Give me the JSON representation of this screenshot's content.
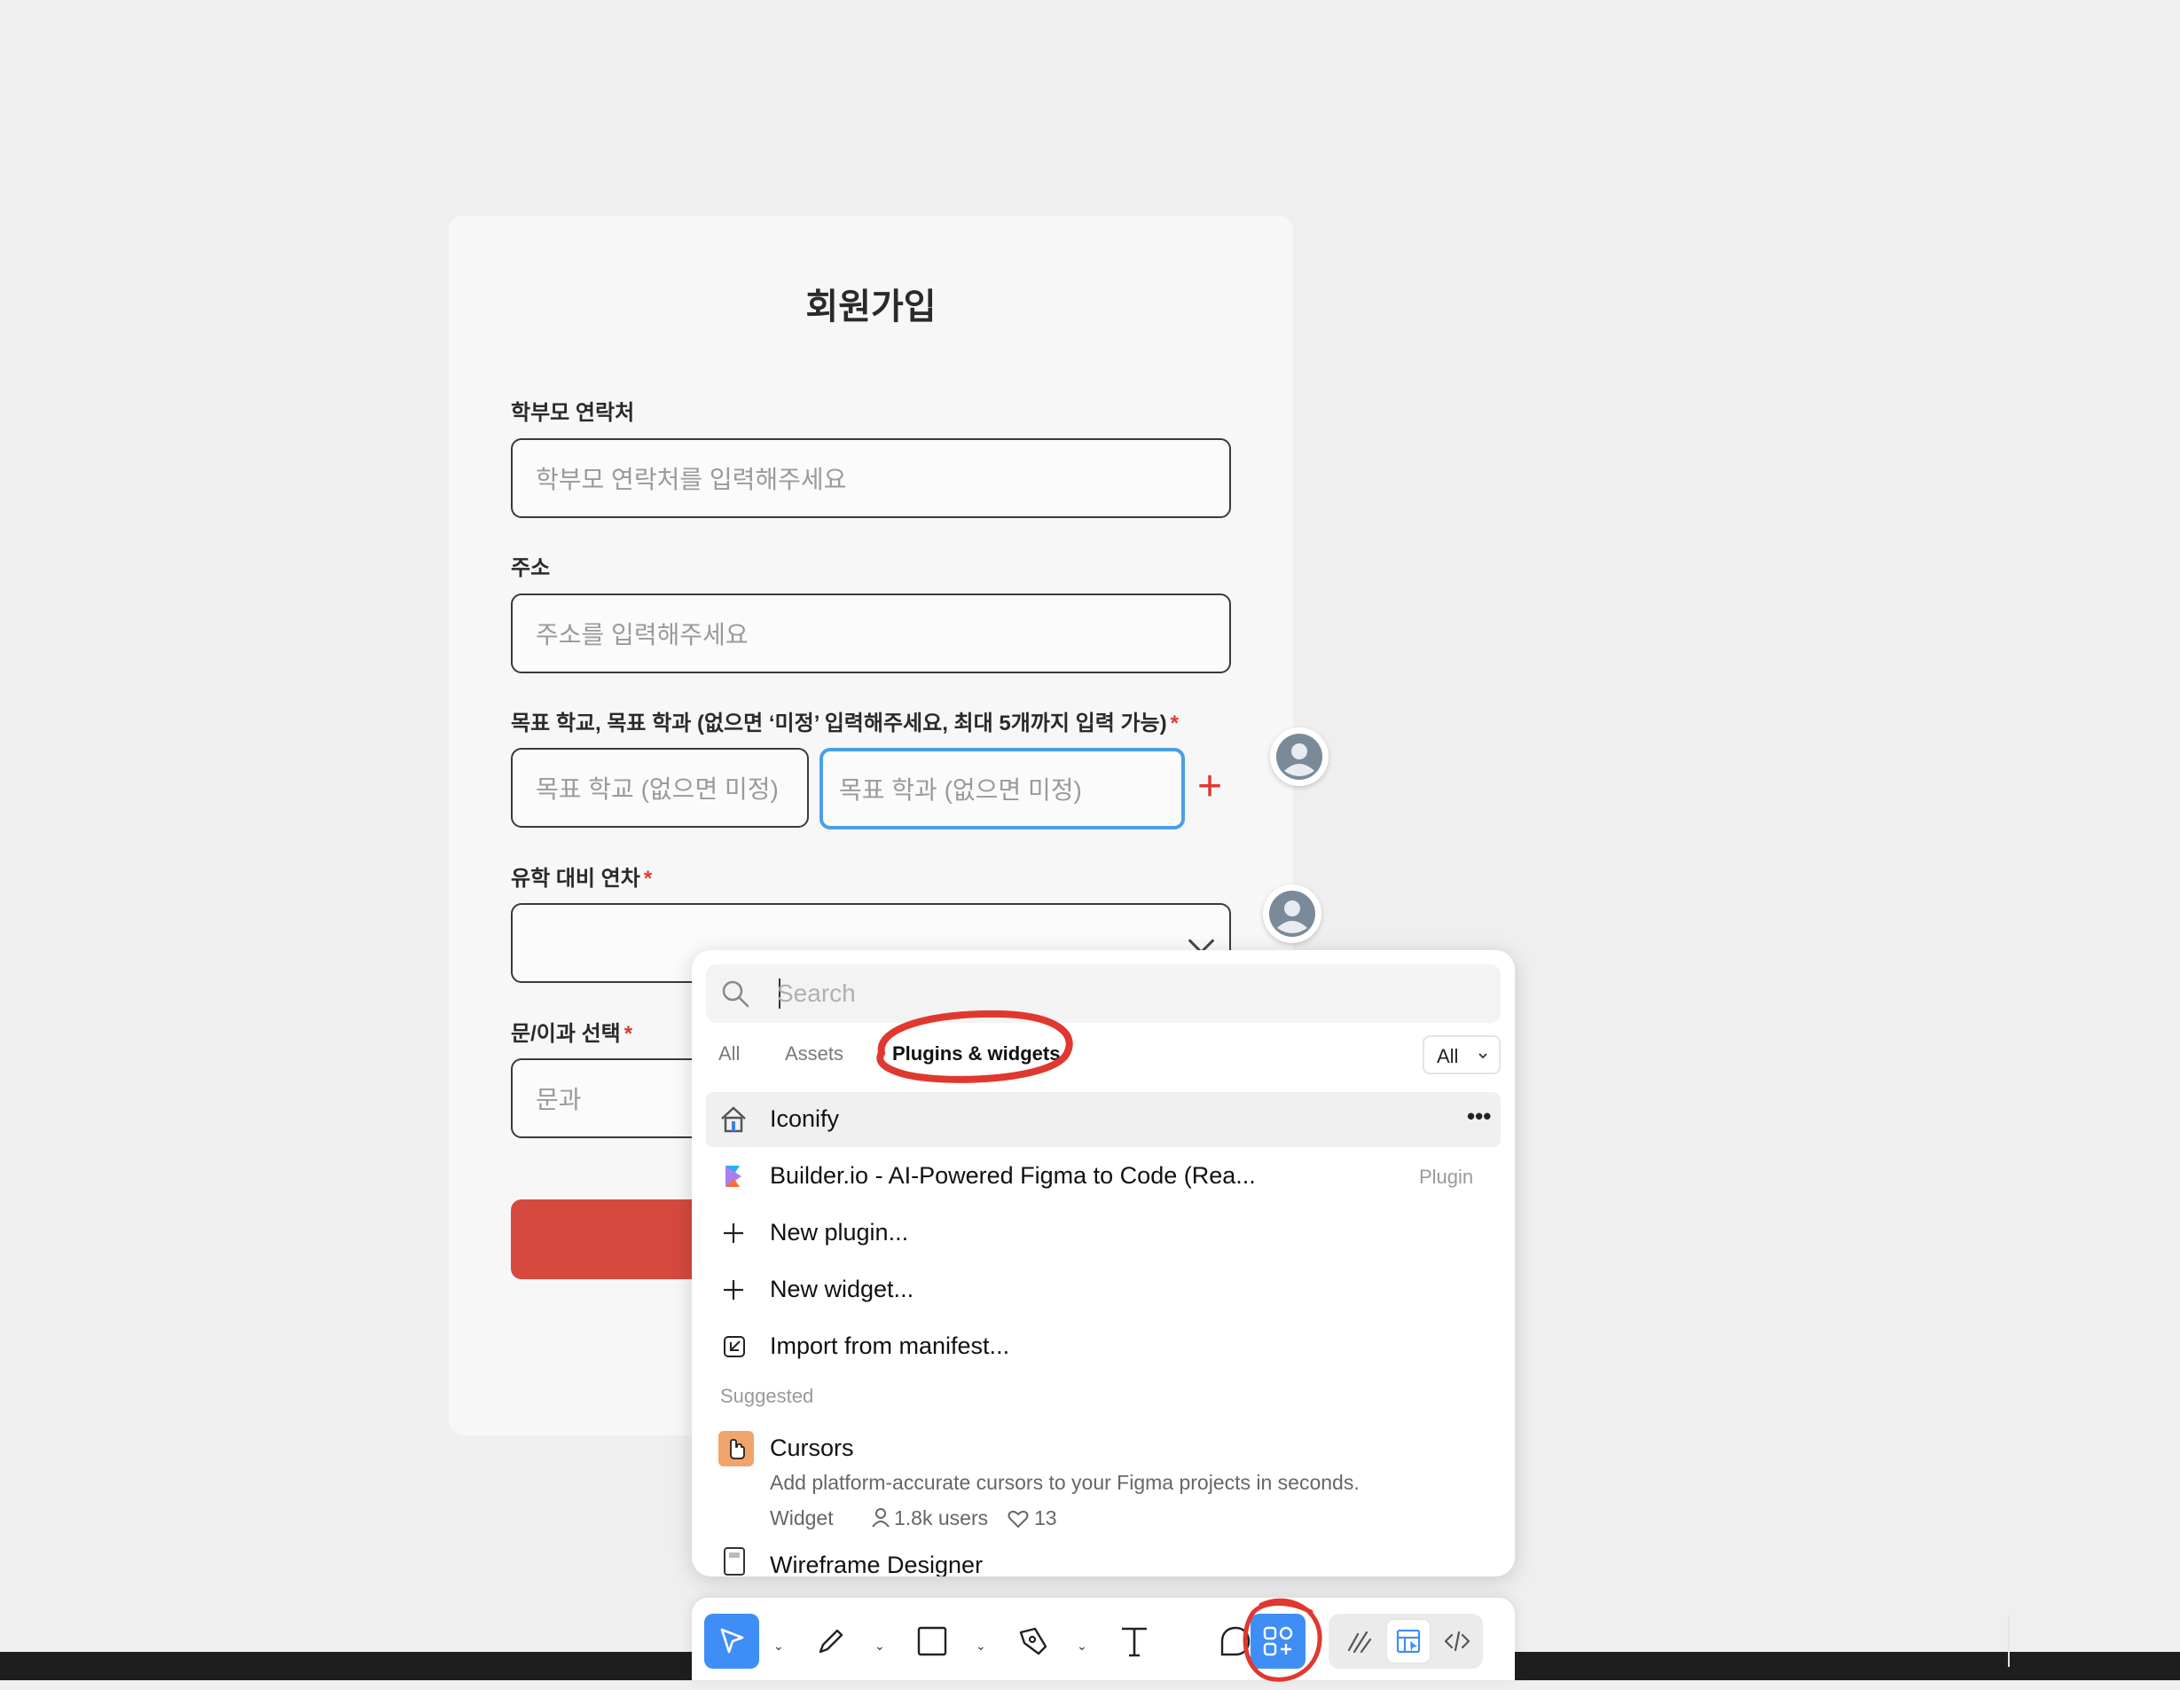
{
  "form": {
    "title": "회원가입",
    "parent_contact": {
      "label": "학부모 연락처",
      "placeholder": "학부모 연락처를 입력해주세요"
    },
    "address": {
      "label": "주소",
      "placeholder": "주소를 입력해주세요"
    },
    "target": {
      "label": "목표 학교, 목표 학과 (없으면 ‘미정’ 입력해주세요, 최대 5개까지 입력 가능)",
      "required_mark": "*",
      "school_placeholder": "목표 학교 (없으면 미정)",
      "major_placeholder": "목표 학과 (없으면 미정)",
      "add_symbol": "+"
    },
    "study_year": {
      "label": "유학 대비 연차",
      "required_mark": "*",
      "value": ""
    },
    "track": {
      "label": "문/이과 선택",
      "required_mark": "*",
      "value": "문과"
    }
  },
  "panel": {
    "search_placeholder": "Search",
    "tabs": [
      "All",
      "Assets",
      "Plugins & widgets"
    ],
    "active_tab": "Plugins & widgets",
    "filter_label": "All",
    "items": [
      {
        "label": "Iconify",
        "icon": "iconify-icon",
        "more": "•••"
      },
      {
        "label": "Builder.io - AI-Powered Figma to Code (Rea...",
        "icon": "builder-icon",
        "tag": "Plugin"
      },
      {
        "label": "New plugin...",
        "icon": "plus-icon"
      },
      {
        "label": "New widget...",
        "icon": "plus-icon"
      },
      {
        "label": "Import from manifest...",
        "icon": "import-icon"
      }
    ],
    "suggested_label": "Suggested",
    "suggested": [
      {
        "title": "Cursors",
        "icon": "cursors-icon",
        "description": "Add platform-accurate cursors to your Figma projects in seconds.",
        "kind": "Widget",
        "users": "1.8k users",
        "likes": "13"
      },
      {
        "title": "Wireframe Designer",
        "icon": "wireframe-icon"
      }
    ]
  },
  "toolbar": {
    "tools": [
      "move-tool",
      "pencil-tool",
      "frame-tool",
      "pen-tool",
      "text-tool",
      "comment-tool",
      "actions-tool",
      "draw-mode",
      "design-mode",
      "dev-mode"
    ],
    "active_tool": "actions-tool",
    "accent": "#3f8ef5"
  },
  "colors": {
    "annotation": "#e0382f",
    "focus": "#4a9fe8",
    "submit": "#d6493f"
  }
}
